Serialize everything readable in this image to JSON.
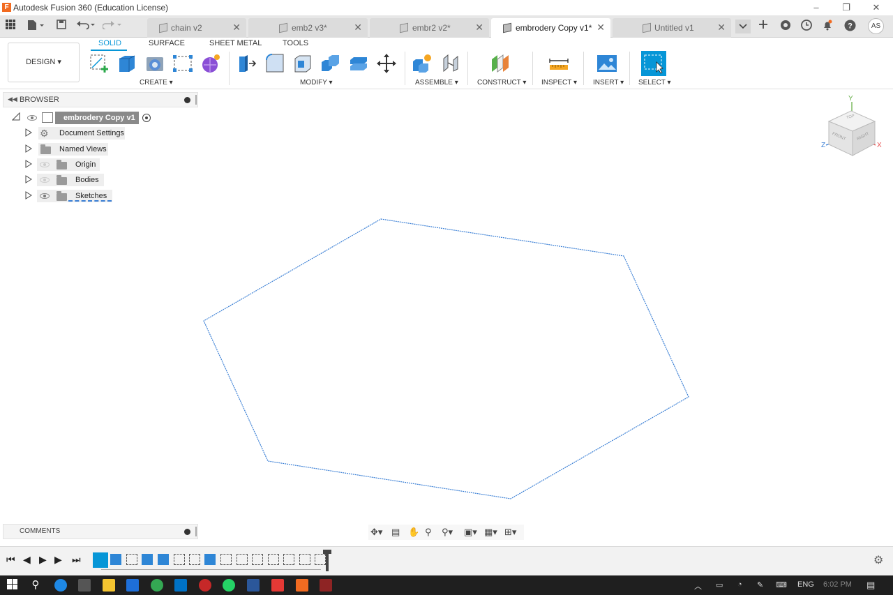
{
  "window": {
    "logo_letter": "F",
    "title": "Autodesk Fusion 360 (Education License)",
    "minimize": "–",
    "restore": "❐",
    "close": "✕"
  },
  "tabbar": {
    "tabs": [
      {
        "label": "chain v2",
        "close": "✕",
        "active": false
      },
      {
        "label": "emb2 v3*",
        "close": "✕",
        "active": false
      },
      {
        "label": "embr2 v2*",
        "close": "✕",
        "active": false
      },
      {
        "label": "embrodery Copy v1*",
        "close": "✕",
        "active": true
      },
      {
        "label": "Untitled v1",
        "close": "✕",
        "active": false
      }
    ],
    "user_initials": "AS"
  },
  "toolbar": {
    "workspace_button": "DESIGN ▾",
    "workspace_tabs": [
      "SOLID",
      "SURFACE",
      "SHEET METAL",
      "TOOLS"
    ],
    "active_tab": "SOLID",
    "groups": {
      "create": "CREATE ▾",
      "modify": "MODIFY ▾",
      "assemble": "ASSEMBLE ▾",
      "construct": "CONSTRUCT ▾",
      "inspect": "INSPECT ▾",
      "insert": "INSERT ▾",
      "select": "SELECT ▾"
    },
    "accent_color": "#0696d7"
  },
  "browser": {
    "title": "BROWSER",
    "root": "embrodery Copy v1",
    "items": [
      {
        "label": "Document Settings",
        "icon": "gear-icon"
      },
      {
        "label": "Named Views",
        "icon": "folder-icon"
      },
      {
        "label": "Origin",
        "icon": "folder-icon"
      },
      {
        "label": "Bodies",
        "icon": "folder-icon"
      },
      {
        "label": "Sketches",
        "icon": "folder-icon"
      }
    ]
  },
  "viewcube": {
    "axis_y": "Y",
    "axis_x": "X",
    "axis_z": "Z",
    "face_top": "TOP",
    "face_front": "FRONT",
    "face_right": "RIGHT"
  },
  "sketch": {
    "shape": "hexagon-profile",
    "line_color": "#3a7fd5"
  },
  "comments": {
    "title": "COMMENTS"
  },
  "taskbar": {
    "language": "ENG",
    "clock": "6:02 PM"
  }
}
